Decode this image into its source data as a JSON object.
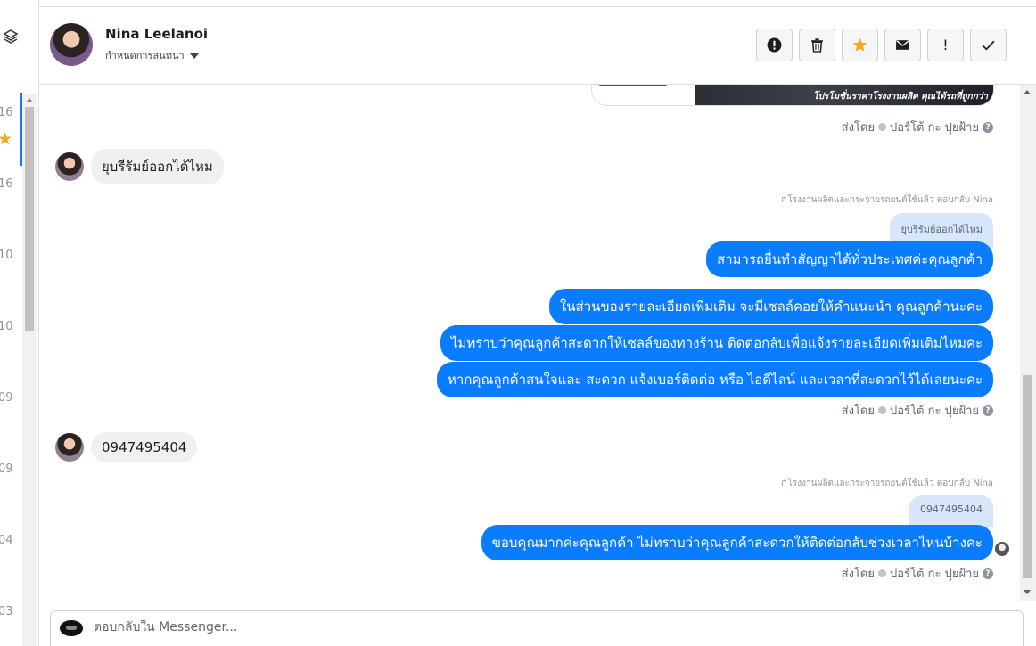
{
  "sidebar": {
    "numbers": [
      "16",
      "16",
      "10",
      "10",
      "09",
      "09",
      "04",
      "03"
    ]
  },
  "header": {
    "contact_name": "Nina Leelanoi",
    "assign_label": "กำหนดการสนทนา"
  },
  "messages": {
    "ad_caption": "โปรโมชั่นราคาโรงงานผลิต คุณได้รถที่ถูกกว่า",
    "sent_by": "ส่งโดย",
    "sender_name": "ปอร์โต้ กะ ปุยฝ้าย",
    "incoming_1": "ยุบรีรัมย์ออกได้ไหม",
    "reply_label_1": "โรงงานผลิตและกระจายรถยนต์ใช้แล้ว ตอบกลับ Nina",
    "quote_1": "ยุบรีรัมย์ออกได้ไหม",
    "reply_1": "สามารถยื่นทำสัญญาได้ทั่วประเทศค่ะคุณลูกค้า",
    "reply_2": "ในส่วนของรายละเอียดเพิ่มเติม จะมีเซลล์คอยให้คำแนะนำ คุณลูกค้านะคะ",
    "reply_3": "ไม่ทราบว่าคุณลูกค้าสะดวกให้เซลล์ของทางร้าน ติดต่อกลับเพื่อแจ้งรายละเอียดเพิ่มเติมไหมคะ",
    "reply_4": "หากคุณลูกค้าสนใจและ สะดวก แจ้งเบอร์ติดต่อ หรือ ไอดีไลน์ และเวลาที่สะดวกไว้ได้เลยนะคะ",
    "incoming_2": "0947495404",
    "reply_label_2": "โรงงานผลิตและกระจายรถยนต์ใช้แล้ว ตอบกลับ Nina",
    "quote_2": "0947495404",
    "reply_5": "ขอบคุณมากค่ะคุณลูกค้า ไม่ทราบว่าคุณลูกค้าสะดวกให้ติดต่อกลับช่วงเวลาไหนบ้างคะ"
  },
  "composer": {
    "placeholder": "ตอบกลับใน Messenger..."
  },
  "icons": [
    "layers-icon",
    "alert-icon",
    "trash-icon",
    "star-icon",
    "mail-icon",
    "exclamation-icon",
    "check-icon"
  ],
  "colors": {
    "accent": "#0a7cff",
    "star": "#f5a623",
    "incoming_bg": "#f0f0f0",
    "quote_bg": "#d8e6fb"
  }
}
